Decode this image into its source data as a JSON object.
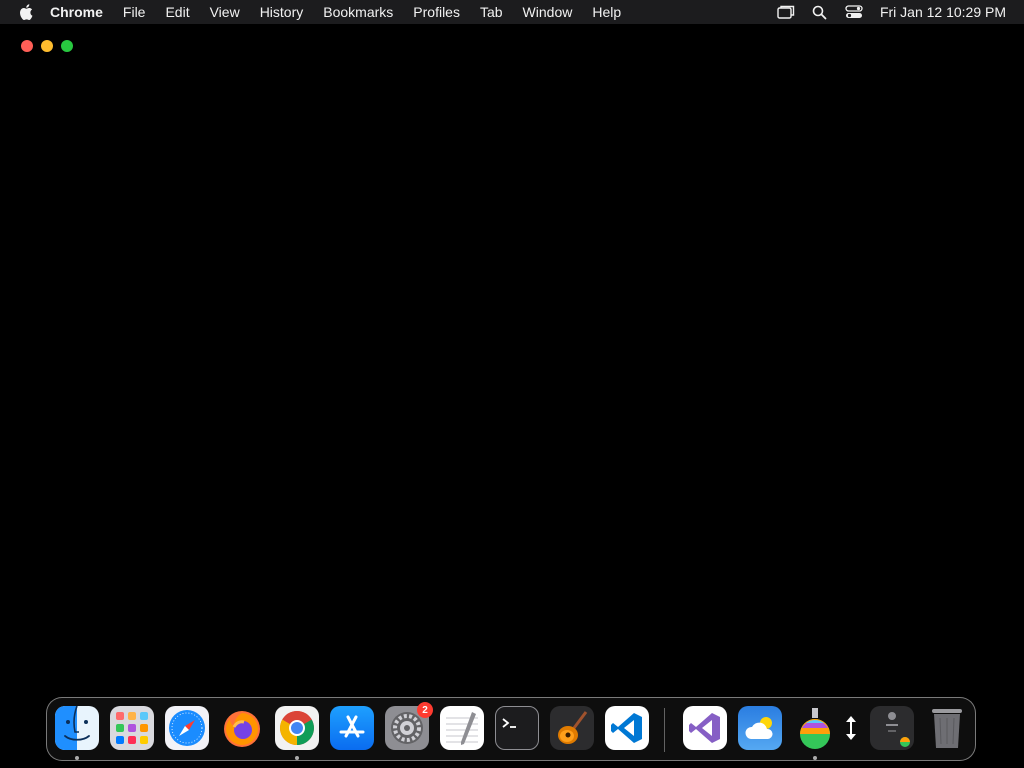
{
  "menubar": {
    "app_name": "Chrome",
    "items": [
      "File",
      "Edit",
      "View",
      "History",
      "Bookmarks",
      "Profiles",
      "Tab",
      "Window",
      "Help"
    ],
    "clock": "Fri Jan 12  10:29 PM",
    "status_icons": [
      "screen-mirroring-icon",
      "search-icon",
      "control-center-icon"
    ]
  },
  "window": {
    "controls": [
      "close",
      "minimize",
      "maximize"
    ]
  },
  "dock": {
    "items": [
      {
        "name": "finder",
        "running": true
      },
      {
        "name": "launchpad",
        "running": false
      },
      {
        "name": "safari",
        "running": false
      },
      {
        "name": "firefox",
        "running": false
      },
      {
        "name": "chrome",
        "running": true
      },
      {
        "name": "app-store",
        "running": false
      },
      {
        "name": "system-settings",
        "running": false,
        "badge": "2"
      },
      {
        "name": "textedit",
        "running": false
      },
      {
        "name": "terminal",
        "running": false
      },
      {
        "name": "garageband",
        "running": false
      },
      {
        "name": "vscode",
        "running": false
      },
      {
        "name": "visual-studio",
        "running": false
      },
      {
        "name": "weather",
        "running": false
      },
      {
        "name": "flask-app",
        "running": true
      },
      {
        "name": "resize-handle",
        "running": false
      },
      {
        "name": "recent-window",
        "running": false
      },
      {
        "name": "trash",
        "running": false
      }
    ]
  },
  "colors": {
    "desktop": "#000000",
    "menubar": "#1c1c1e",
    "badge": "#ff3b30",
    "close": "#ff5f57",
    "minimize": "#febc2e",
    "maximize": "#28c840"
  }
}
